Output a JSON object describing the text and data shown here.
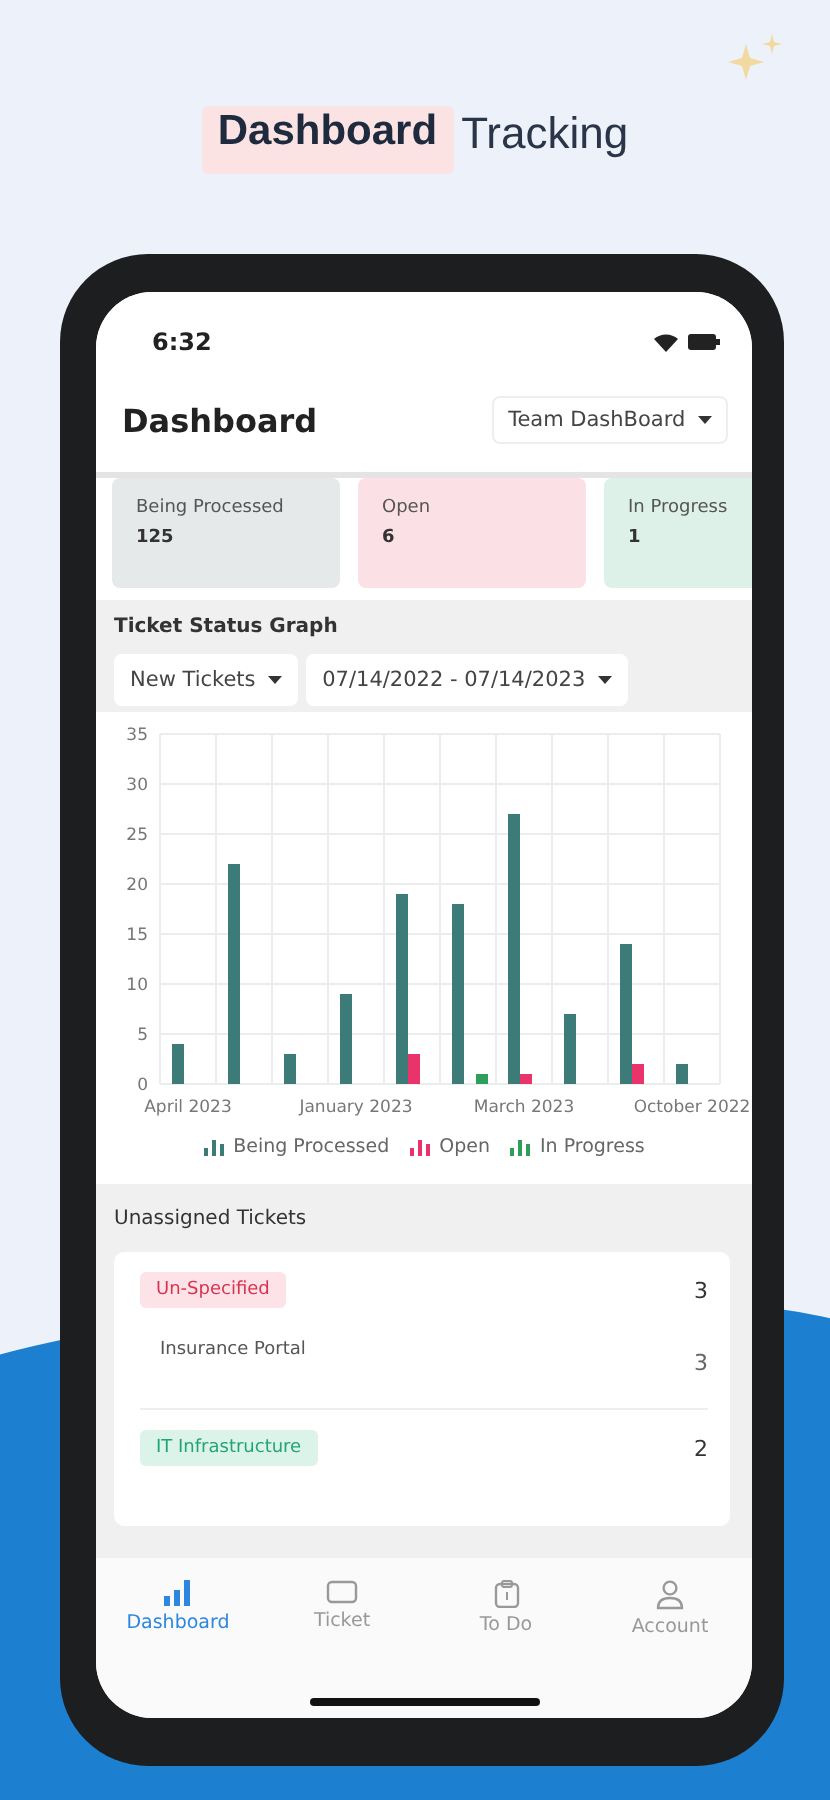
{
  "headline": {
    "highlight": "Dashboard",
    "rest": "Tracking"
  },
  "status_bar": {
    "time": "6:32"
  },
  "header": {
    "title": "Dashboard",
    "dropdown": "Team DashBoard"
  },
  "summary_cards": [
    {
      "label": "Being Processed",
      "value": "125",
      "color": "#e6e9ea"
    },
    {
      "label": "Open",
      "value": "6",
      "color": "#fbe1e6"
    },
    {
      "label": "In Progress",
      "value": "1",
      "color": "#ddf1e8"
    }
  ],
  "graph": {
    "title": "Ticket Status Graph",
    "filters": [
      "New Tickets",
      "07/14/2022 - 07/14/2023"
    ],
    "chart_data": {
      "type": "bar",
      "categories": [
        "April 2023",
        null,
        null,
        "January 2023",
        null,
        null,
        "March 2023",
        null,
        null,
        "October 2022"
      ],
      "series": [
        {
          "name": "Being Processed",
          "color": "#3d7b79",
          "values": [
            4,
            22,
            3,
            9,
            19,
            18,
            27,
            7,
            14,
            2
          ]
        },
        {
          "name": "Open",
          "color": "#e8336b",
          "values": [
            0,
            0,
            0,
            0,
            3,
            0,
            1,
            0,
            2,
            0
          ]
        },
        {
          "name": "In Progress",
          "color": "#2e9e5a",
          "values": [
            0,
            0,
            0,
            0,
            0,
            1,
            0,
            0,
            0,
            0
          ]
        }
      ],
      "grid": true,
      "legend": "bottom",
      "ylim": [
        0,
        35
      ],
      "yticks": [
        0,
        5,
        10,
        15,
        20,
        25,
        30,
        35
      ]
    }
  },
  "unassigned": {
    "title": "Unassigned Tickets",
    "groups": [
      {
        "tag": "Un-Specified",
        "count": "3",
        "kind": "danger",
        "items": [
          {
            "name": "Insurance Portal",
            "count": "3"
          }
        ]
      },
      {
        "tag": "IT Infrastructure",
        "count": "2",
        "kind": "success"
      }
    ]
  },
  "nav": [
    {
      "label": "Dashboard",
      "selected": true
    },
    {
      "label": "Ticket",
      "selected": false
    },
    {
      "label": "To Do",
      "selected": false
    },
    {
      "label": "Account",
      "selected": false
    }
  ]
}
